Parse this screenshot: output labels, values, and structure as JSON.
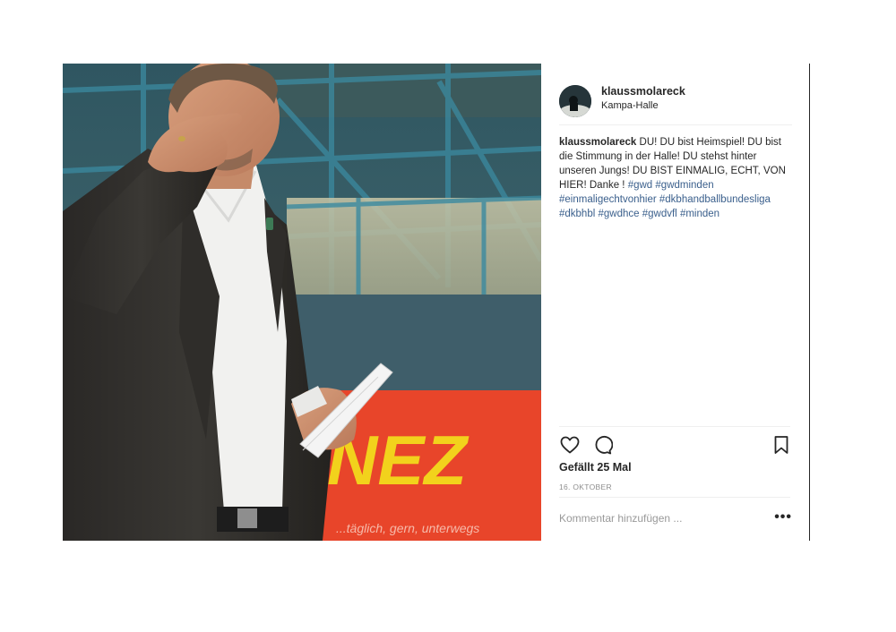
{
  "post": {
    "username": "klaussmolareck",
    "location": "Kampa-Halle",
    "caption_user": "klaussmolareck",
    "caption_text": " DU! DU bist Heimspiel! DU bist die Stimmung in der Halle! DU stehst hinter unseren Jungs! DU BIST EINMALIG, ECHT, VON HIER! Danke ! ",
    "hashtags": [
      "#gwd",
      "#gwdminden",
      "#einmaligechtvonhier",
      "#dkbhandballbundesliga",
      "#dkbhbl",
      "#gwdhce",
      "#gwdvfl",
      "#minden"
    ],
    "likes": "Gefällt 25 Mal",
    "date": "16. Oktober",
    "comment_placeholder": "Kommentar hinzufügen ...",
    "more_label": "•••"
  },
  "photo": {
    "banner_text": "NEZ",
    "banner_subtext": "...täglich, gern, unterwegs"
  },
  "icons": {
    "like": "heart-icon",
    "comment": "speech-bubble-icon",
    "save": "bookmark-icon",
    "more": "more-options-icon"
  },
  "colors": {
    "hashtag": "#3a5f8c",
    "banner_red": "#e8452a",
    "banner_yellow": "#f2d21c",
    "muted": "#8e8e8e"
  }
}
